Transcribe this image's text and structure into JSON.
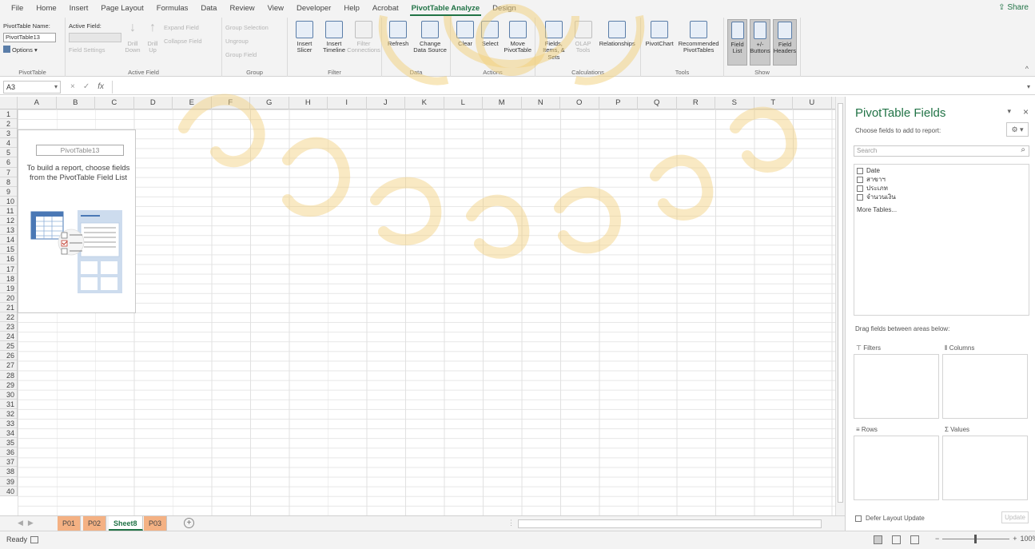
{
  "menu": {
    "tabs": [
      "File",
      "Home",
      "Insert",
      "Page Layout",
      "Formulas",
      "Data",
      "Review",
      "View",
      "Developer",
      "Help",
      "Acrobat",
      "PivotTable Analyze",
      "Design"
    ],
    "active_tab": "PivotTable Analyze",
    "share": "Share"
  },
  "ribbon": {
    "pivottable": {
      "name_label": "PivotTable Name:",
      "name_value": "PivotTable13",
      "options": "Options",
      "group": "PivotTable"
    },
    "active_field": {
      "label": "Active Field:",
      "field_settings": "Field Settings",
      "drill_down": "Drill Down",
      "drill_up": "Drill Up",
      "expand": "Expand Field",
      "collapse": "Collapse Field",
      "group": "Active Field"
    },
    "group_grp": {
      "selection": "Group Selection",
      "ungroup": "Ungroup",
      "field": "Group Field",
      "group": "Group"
    },
    "filter": {
      "slicer": "Insert Slicer",
      "timeline": "Insert Timeline",
      "connections": "Filter Connections",
      "group": "Filter"
    },
    "data": {
      "refresh": "Refresh",
      "change_source": "Change Data Source",
      "group": "Data"
    },
    "actions": {
      "clear": "Clear",
      "select": "Select",
      "move": "Move PivotTable",
      "group": "Actions"
    },
    "calculations": {
      "fields_items": "Fields, Items, & Sets",
      "olap": "OLAP Tools",
      "relationships": "Relationships",
      "group": "Calculations"
    },
    "tools": {
      "pivotchart": "PivotChart",
      "recommended": "Recommended PivotTables",
      "group": "Tools"
    },
    "show": {
      "field_list": "Field List",
      "buttons": "+/- Buttons",
      "headers": "Field Headers",
      "group": "Show"
    }
  },
  "formula": {
    "namebox": "A3",
    "fx": "fx",
    "cancel": "×",
    "enter": "✓"
  },
  "grid": {
    "columns": [
      "A",
      "B",
      "C",
      "D",
      "E",
      "F",
      "G",
      "H",
      "I",
      "J",
      "K",
      "L",
      "M",
      "N",
      "O",
      "P",
      "Q",
      "R",
      "S",
      "T",
      "U"
    ],
    "rows": [
      "1",
      "2",
      "3",
      "4",
      "5",
      "6",
      "7",
      "8",
      "9",
      "10",
      "11",
      "12",
      "13",
      "14",
      "15",
      "16",
      "17",
      "18",
      "19",
      "20",
      "21",
      "22",
      "23",
      "24",
      "25",
      "26",
      "27",
      "28",
      "29",
      "30",
      "31",
      "32",
      "33",
      "34",
      "35",
      "36",
      "37",
      "38",
      "39",
      "40"
    ]
  },
  "pivot_placeholder": {
    "name": "PivotTable13",
    "msg_line1": "To build a report, choose fields",
    "msg_line2": "from the PivotTable Field List"
  },
  "sheets": [
    {
      "name": "P01",
      "style": "orange"
    },
    {
      "name": "P02",
      "style": "orange"
    },
    {
      "name": "Sheet8",
      "style": "active"
    },
    {
      "name": "P03",
      "style": "orange"
    }
  ],
  "status": {
    "ready": "Ready",
    "zoom": "100%"
  },
  "pane": {
    "title": "PivotTable Fields",
    "choose": "Choose fields to add to report:",
    "search_placeholder": "Search",
    "fields": [
      "Date",
      "สาขาฯ",
      "ประเภท",
      "จำนวนเงิน"
    ],
    "more_tables": "More Tables...",
    "drag_text": "Drag fields between areas below:",
    "filters": "Filters",
    "columns": "Columns",
    "rows": "Rows",
    "values": "Values",
    "defer": "Defer Layout Update",
    "update": "Update"
  }
}
